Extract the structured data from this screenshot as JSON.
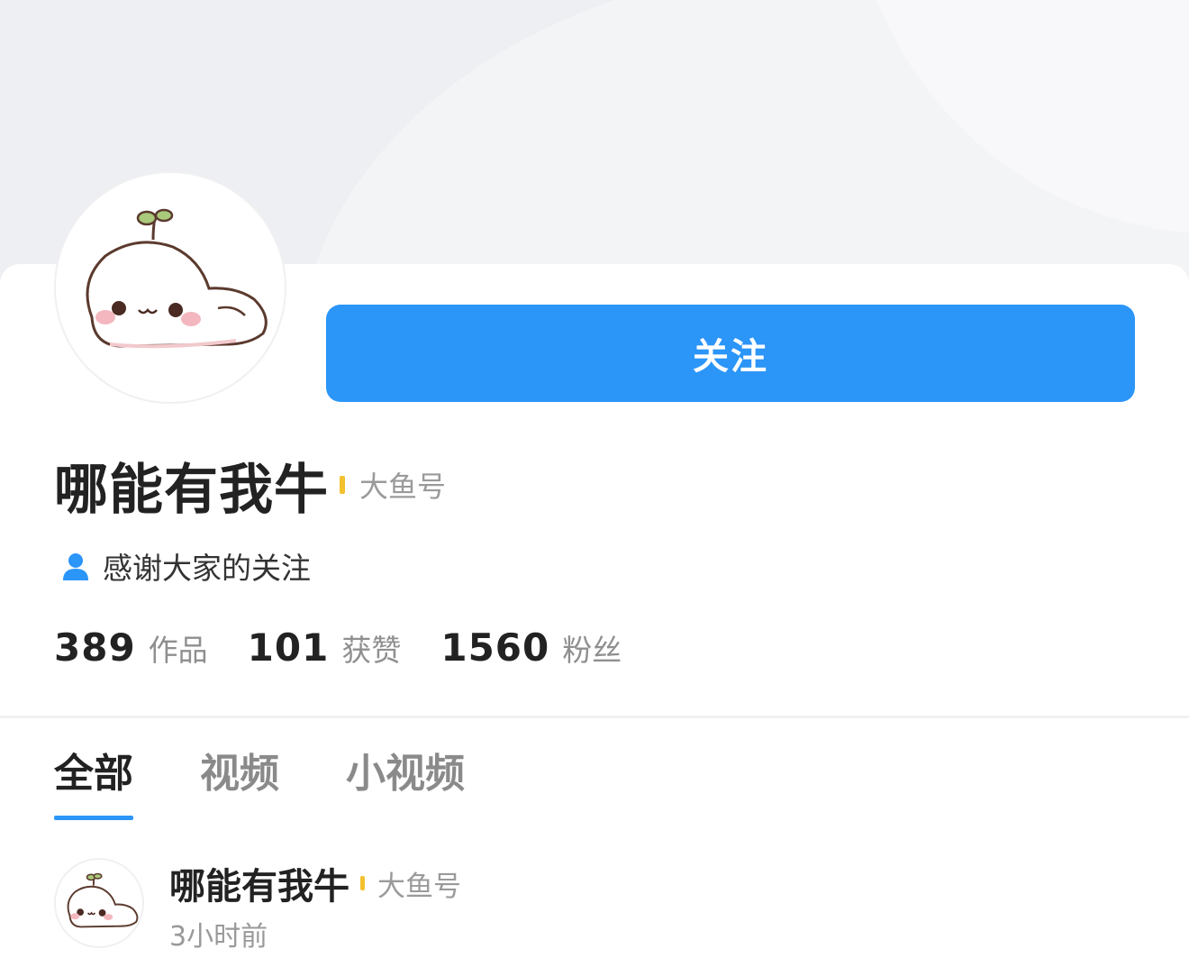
{
  "profile": {
    "name": "哪能有我牛",
    "source_tag": "大鱼号",
    "bio": "感谢大家的关注",
    "follow_label": "关注",
    "stats": {
      "works_count": "389",
      "works_label": "作品",
      "likes_count": "101",
      "likes_label": "获赞",
      "fans_count": "1560",
      "fans_label": "粉丝"
    }
  },
  "tabs": [
    {
      "label": "全部",
      "active": true
    },
    {
      "label": "视频",
      "active": false
    },
    {
      "label": "小视频",
      "active": false
    }
  ],
  "post": {
    "author": "哪能有我牛",
    "source_tag": "大鱼号",
    "time": "3小时前"
  },
  "colors": {
    "accent": "#2b95f8",
    "tag_bar": "#f2c12e",
    "banner_bg": "#eeeff2"
  },
  "icons": {
    "bio": "user-icon",
    "avatar": "cartoon-mascot"
  }
}
